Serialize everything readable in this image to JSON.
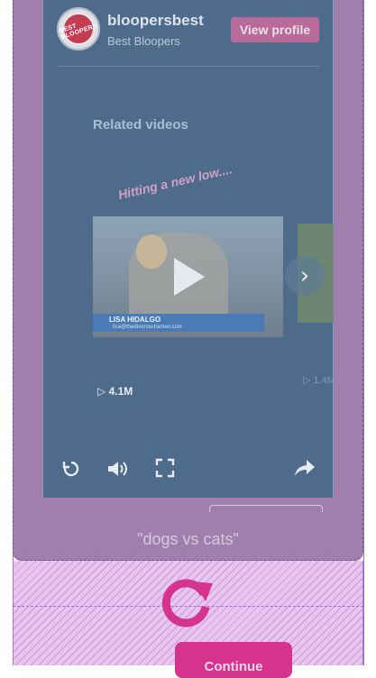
{
  "profile": {
    "name": "bloopersbest",
    "subtitle": "Best Bloopers",
    "view_profile_label": "View profile",
    "avatar_text": "BEST BLOOPERS"
  },
  "related": {
    "title": "Related videos",
    "videos": [
      {
        "caption": "Hitting a new low....",
        "lower_third_name": "LISA HIDALGO",
        "lower_third_url": "lisa@thedivorcechannel.com",
        "views": "4.1M"
      },
      {
        "views": "1.4M"
      }
    ]
  },
  "controls": {
    "replay": "replay-icon",
    "volume": "volume-icon",
    "fullscreen": "fullscreen-icon",
    "share": "share-icon"
  },
  "search": {
    "query": "\"dogs vs cats\""
  },
  "captcha": {
    "continue_label": "Continue"
  },
  "colors": {
    "accent": "#d6338f",
    "panel": "#4e6b8c",
    "overlay": "#a07fae"
  }
}
